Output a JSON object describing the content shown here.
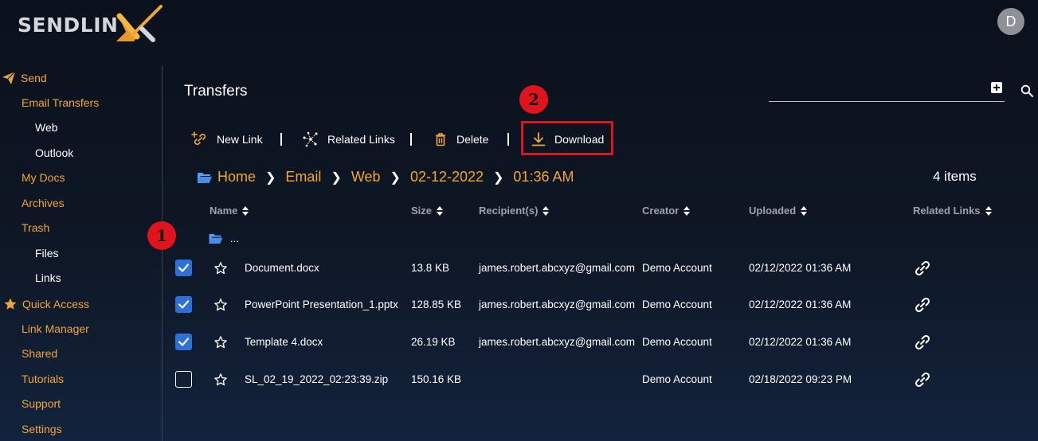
{
  "app": {
    "logo_text": "SENDLIN",
    "logo_x": "X",
    "avatar_initial": "D"
  },
  "sidebar": {
    "items": [
      {
        "label": "Send",
        "icon": "paper-plane-icon"
      },
      {
        "label": "Email Transfers"
      },
      {
        "label": "Web"
      },
      {
        "label": "Outlook"
      },
      {
        "label": "My Docs"
      },
      {
        "label": "Archives"
      },
      {
        "label": "Trash"
      },
      {
        "label": "Files"
      },
      {
        "label": "Links"
      },
      {
        "label": "Quick Access",
        "icon": "star-icon"
      },
      {
        "label": "Link Manager"
      },
      {
        "label": "Shared"
      },
      {
        "label": "Tutorials"
      },
      {
        "label": "Support"
      },
      {
        "label": "Settings"
      }
    ]
  },
  "main": {
    "title": "Transfers",
    "items_count": "4 items"
  },
  "toolbar": {
    "new_link": "New Link",
    "related_links": "Related Links",
    "delete": "Delete",
    "download": "Download"
  },
  "annotations": {
    "step1": "1",
    "step2": "2"
  },
  "breadcrumb": [
    "Home",
    "Email",
    "Web",
    "02-12-2022",
    "01:36 AM"
  ],
  "table": {
    "columns": [
      "Name",
      "Size",
      "Recipient(s)",
      "Creator",
      "Uploaded",
      "Related Links"
    ],
    "parent_folder": "...",
    "rows": [
      {
        "checked": true,
        "name": "Document.docx",
        "size": "13.8 KB",
        "recipient": "james.robert.abcxyz@gmail.com",
        "creator": "Demo Account",
        "uploaded": "02/12/2022 01:36 AM"
      },
      {
        "checked": true,
        "name": "PowerPoint Presentation_1.pptx",
        "size": "128.85 KB",
        "recipient": "james.robert.abcxyz@gmail.com",
        "creator": "Demo Account",
        "uploaded": "02/12/2022 01:36 AM"
      },
      {
        "checked": true,
        "name": "Template 4.docx",
        "size": "26.19 KB",
        "recipient": "james.robert.abcxyz@gmail.com",
        "creator": "Demo Account",
        "uploaded": "02/12/2022 01:36 AM"
      },
      {
        "checked": false,
        "name": "SL_02_19_2022_02:23:39.zip",
        "size": "150.16 KB",
        "recipient": "",
        "creator": "Demo Account",
        "uploaded": "02/18/2022 09:23 PM"
      }
    ]
  },
  "colors": {
    "accent": "#f0a637",
    "checkbox": "#2e6fd8",
    "annotation": "#e0141c"
  }
}
